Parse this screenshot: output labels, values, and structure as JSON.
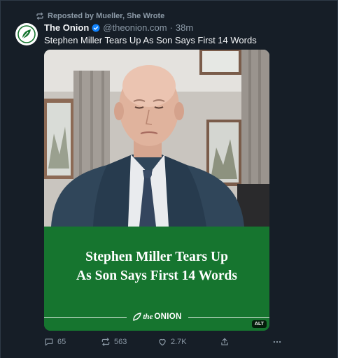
{
  "repost": {
    "text": "Reposted by Mueller, She Wrote",
    "icon": "repost-icon"
  },
  "post": {
    "author_name": "The Onion",
    "handle": "@theonion.com",
    "separator": "·",
    "time": "38m",
    "text": "Stephen Miller Tears Up As Son Says First 14 Words",
    "avatar_icon": "onion-logo-icon"
  },
  "embed": {
    "headline_line1": "Stephen Miller Tears Up",
    "headline_line2": "As Son Says First 14 Words",
    "brand_prefix": "the",
    "brand_name": "ONION",
    "alt_badge": "ALT",
    "background_color": "#16752f"
  },
  "actions": {
    "replies": "65",
    "reposts": "563",
    "likes": "2.7K"
  },
  "colors": {
    "background": "#161e27",
    "muted": "#8b99a6",
    "verified": "#1083fe",
    "brand_green": "#16752f"
  }
}
